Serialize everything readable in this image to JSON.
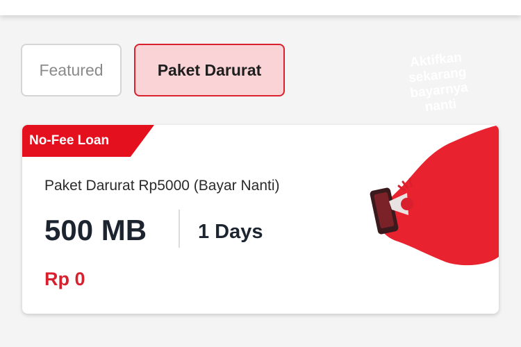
{
  "tabs": [
    {
      "label": "Featured",
      "active": false
    },
    {
      "label": "Paket Darurat",
      "active": true
    }
  ],
  "card": {
    "badge": "No-Fee Loan",
    "name": "Paket Darurat Rp5000 (Bayar Nanti)",
    "quota": "500 MB",
    "duration": "1 Days",
    "price": "Rp 0",
    "promo_lines": [
      "Aktifkan",
      "sekarang",
      "bayarnya",
      "nanti"
    ]
  },
  "colors": {
    "accent": "#e4101e",
    "tab_active_bg": "#f9d3d6",
    "price": "#d9202f"
  },
  "icons": [
    "phone-megaphone-icon"
  ]
}
